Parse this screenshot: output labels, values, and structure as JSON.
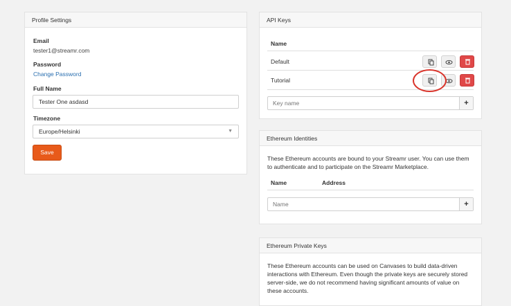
{
  "profile": {
    "title": "Profile Settings",
    "email_label": "Email",
    "email_value": "tester1@streamr.com",
    "password_label": "Password",
    "change_password": "Change Password",
    "fullname_label": "Full Name",
    "fullname_value": "Tester One asdasd",
    "timezone_label": "Timezone",
    "timezone_value": "Europe/Helsinki",
    "save_label": "Save"
  },
  "api_keys": {
    "title": "API Keys",
    "name_header": "Name",
    "keys": [
      {
        "name": "Default"
      },
      {
        "name": "Tutorial"
      }
    ],
    "input_placeholder": "Key name",
    "add_label": "+"
  },
  "identities": {
    "title": "Ethereum Identities",
    "description": "These Ethereum accounts are bound to your Streamr user. You can use them to authenticate and to participate on the Streamr Marketplace.",
    "name_header": "Name",
    "address_header": "Address",
    "input_placeholder": "Name",
    "add_label": "+"
  },
  "private_keys": {
    "title": "Ethereum Private Keys",
    "description": "These Ethereum accounts can be used on Canvases to build data-driven interactions with Ethereum. Even though the private keys are securely stored server-side, we do not recommend having significant amounts of value on these accounts."
  },
  "colors": {
    "accent": "#e85a1a",
    "danger": "#e04848",
    "link": "#2a6fb0",
    "highlight": "#d9342b"
  },
  "icons": {
    "copy": "copy-icon",
    "eye": "eye-icon",
    "trash": "trash-icon",
    "caret": "chevron-down-icon"
  }
}
